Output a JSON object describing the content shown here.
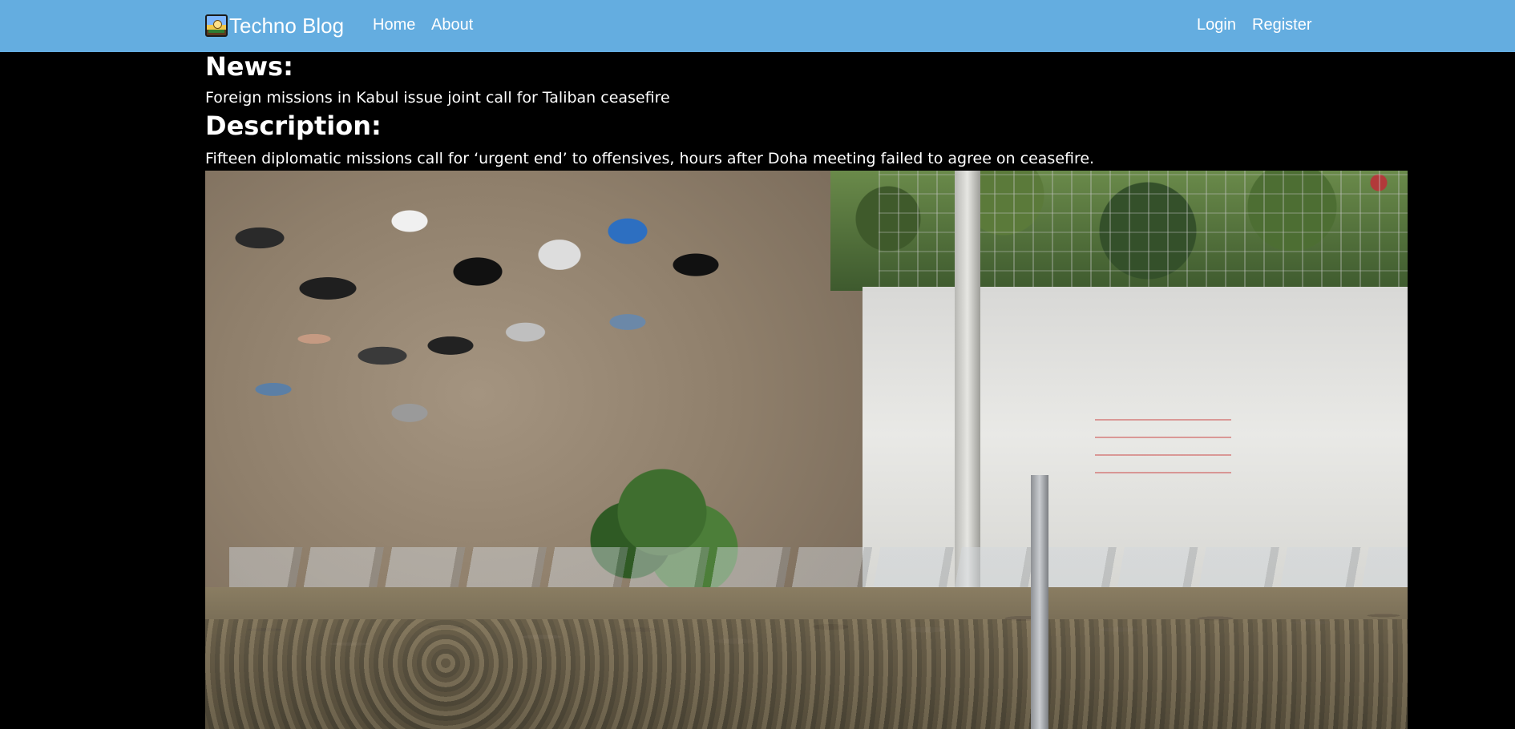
{
  "navbar": {
    "brand": {
      "title": "Techno Blog",
      "logo_icon": "blog-logo-icon"
    },
    "links_left": [
      "Home",
      "About"
    ],
    "links_right": [
      "Login",
      "Register"
    ],
    "background_color": "#64ade0"
  },
  "article": {
    "news_heading": "News:",
    "news_title": "Foreign missions in Kabul issue joint call for Taliban ceasefire",
    "description_heading": "Description:",
    "description": "Fifteen diplomatic missions call for ‘urgent end’ to offensives, hours after Doha meeting failed to agree on ceasefire."
  },
  "page": {
    "background_color": "#000000",
    "text_color": "#ffffff"
  }
}
